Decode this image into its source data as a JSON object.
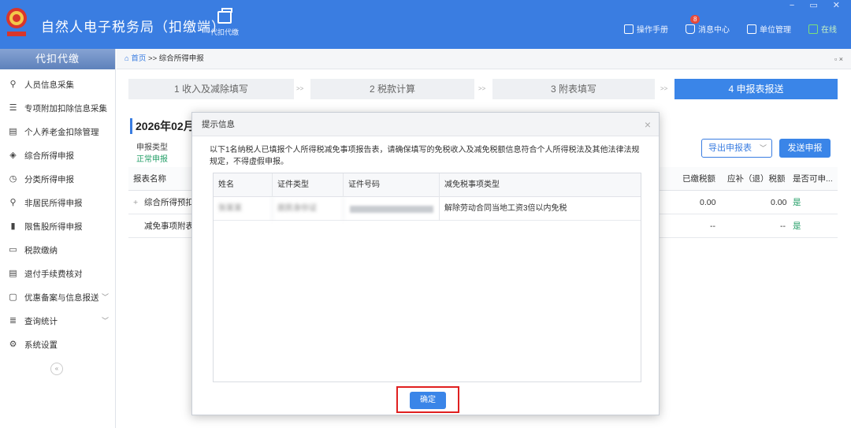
{
  "app": {
    "title": "自然人电子税务局（扣缴端）",
    "tool_label": "代扣代缴",
    "window_controls": "− ▭ ✕"
  },
  "top_links": [
    {
      "label": "操作手册",
      "icon": "book-icon"
    },
    {
      "label": "消息中心",
      "icon": "message-icon",
      "badge": "8"
    },
    {
      "label": "单位管理",
      "icon": "building-icon"
    },
    {
      "label": "在线",
      "icon": "online-icon"
    }
  ],
  "sidebar": {
    "header": "代扣代缴",
    "items": [
      {
        "label": "人员信息采集",
        "icon": "person-icon",
        "glyph": "⚲"
      },
      {
        "label": "专项附加扣除信息采集",
        "icon": "list-icon",
        "glyph": "☰"
      },
      {
        "label": "个人养老金扣除管理",
        "icon": "document-icon",
        "glyph": "▤"
      },
      {
        "label": "综合所得申报",
        "icon": "layers-icon",
        "glyph": "◈"
      },
      {
        "label": "分类所得申报",
        "icon": "clock-icon",
        "glyph": "◷"
      },
      {
        "label": "非居民所得申报",
        "icon": "user-icon",
        "glyph": "⚲"
      },
      {
        "label": "限售股所得申报",
        "icon": "chart-icon",
        "glyph": "▮"
      },
      {
        "label": "税款缴纳",
        "icon": "wallet-icon",
        "glyph": "▭"
      },
      {
        "label": "退付手续费核对",
        "icon": "receipt-icon",
        "glyph": "▤"
      },
      {
        "label": "优惠备案与信息报送",
        "icon": "file-icon",
        "glyph": "▢",
        "expandable": true
      },
      {
        "label": "查询统计",
        "icon": "search-list-icon",
        "glyph": "≣",
        "expandable": true
      },
      {
        "label": "系统设置",
        "icon": "gear-icon",
        "glyph": "⚙"
      }
    ]
  },
  "breadcrumb": {
    "home": "首页",
    "separator": ">>",
    "current": "综合所得申报",
    "close": "▫ ×"
  },
  "steps": [
    {
      "label": "1 收入及减除填写",
      "active": false
    },
    {
      "label": "2 税款计算",
      "active": false
    },
    {
      "label": "3 附表填写",
      "active": false
    },
    {
      "label": "4 申报表报送",
      "active": true
    }
  ],
  "step_separator": ">>",
  "period": "2026年02月",
  "declaration": {
    "type_label": "申报类型",
    "type_value": "正常申报",
    "export_label": "导出申报表",
    "send_label": "发送申报"
  },
  "main_table": {
    "headers": [
      "报表名称",
      "已缴税额",
      "应补（退）税额",
      "是否可申..."
    ],
    "rows": [
      {
        "name": "综合所得预扣",
        "paid": "0.00",
        "due": "0.00",
        "can_declare": "是",
        "prefix": "+"
      },
      {
        "name": "减免事项附表",
        "paid": "--",
        "due": "--",
        "can_declare": "是",
        "prefix": ""
      }
    ]
  },
  "dialog": {
    "title": "提示信息",
    "message": "以下1名纳税人已填报个人所得税减免事项报告表，请确保填写的免税收入及减免税额信息符合个人所得税法及其他法律法规规定，不得虚假申报。",
    "columns": [
      "姓名",
      "证件类型",
      "证件号码",
      "减免税事项类型"
    ],
    "rows": [
      {
        "name": "张某某",
        "id_type": "居民身份证",
        "id_number": "",
        "type": "解除劳动合同当地工资3倍以内免税"
      }
    ],
    "confirm_label": "确定"
  }
}
